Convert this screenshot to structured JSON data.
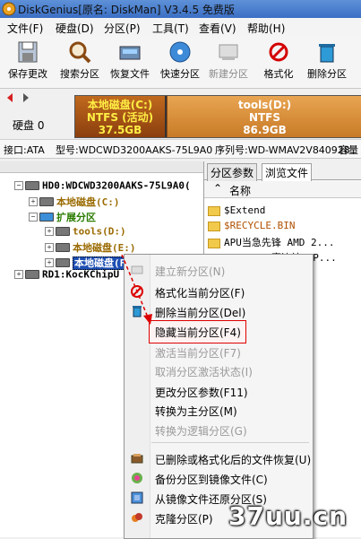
{
  "window": {
    "title": "DiskGenius[原名: DiskMan] V3.4.5 免费版"
  },
  "menu": [
    "文件(F)",
    "硬盘(D)",
    "分区(P)",
    "工具(T)",
    "查看(V)",
    "帮助(H)"
  ],
  "toolbar": [
    {
      "label": "保存更改",
      "icon": "save-icon",
      "enabled": true
    },
    {
      "label": "搜索分区",
      "icon": "search-icon",
      "enabled": true
    },
    {
      "label": "恢复文件",
      "icon": "recover-icon",
      "enabled": true
    },
    {
      "label": "快速分区",
      "icon": "disk-icon",
      "enabled": true
    },
    {
      "label": "新建分区",
      "icon": "new-partition-icon",
      "enabled": false
    },
    {
      "label": "格式化",
      "icon": "format-icon",
      "enabled": true
    },
    {
      "label": "删除分区",
      "icon": "trash-icon",
      "enabled": true
    }
  ],
  "disk_panel": {
    "disk_label": "硬盘 0",
    "partitions": [
      {
        "name": "本地磁盘(C:)",
        "fs": "NTFS (活动)",
        "size": "37.5GB"
      },
      {
        "name": "tools(D:)",
        "fs": "NTFS",
        "size": "86.9GB"
      }
    ]
  },
  "info": {
    "interface": "接口:ATA",
    "model": "型号:WDCWD3200AAKS-75L9A0",
    "serial": "序列号:WD-WMAV2V840928",
    "capacity": "容量"
  },
  "tree": {
    "hd0": "HD0:WDCWD3200AAKS-75L9A0(",
    "c": "本地磁盘(C:)",
    "ext": "扩展分区",
    "d": "tools(D:)",
    "e": "本地磁盘(E:)",
    "f": "本地磁盘(F:)",
    "rd1": "RD1:KocKChipU"
  },
  "tabs": [
    "分区参数",
    "浏览文件"
  ],
  "file_list": {
    "header": "名称",
    "items": [
      "$Extend",
      "$RECYCLE.BIN",
      "APU当急先锋 AMD 2...",
      "Aton-ION赛边站 AP..."
    ]
  },
  "context_menu": [
    {
      "label": "建立新分区(N)",
      "enabled": false,
      "icon": "new-partition-icon"
    },
    {
      "label": "格式化当前分区(F)",
      "enabled": true,
      "icon": "format-icon"
    },
    {
      "label": "删除当前分区(Del)",
      "enabled": true,
      "icon": "trash-icon"
    },
    {
      "label": "隐藏当前分区(F4)",
      "enabled": true,
      "icon": "",
      "highlighted": true
    },
    {
      "label": "激活当前分区(F7)",
      "enabled": false,
      "icon": ""
    },
    {
      "label": "取消分区激活状态(I)",
      "enabled": false,
      "icon": ""
    },
    {
      "label": "更改分区参数(F11)",
      "enabled": true,
      "icon": ""
    },
    {
      "label": "转换为主分区(M)",
      "enabled": true,
      "icon": ""
    },
    {
      "label": "转换为逻辑分区(G)",
      "enabled": false,
      "icon": ""
    },
    {
      "label": "已删除或格式化后的文件恢复(U)",
      "enabled": true,
      "icon": "recover-icon"
    },
    {
      "label": "备份分区到镜像文件(C)",
      "enabled": true,
      "icon": "backup-icon"
    },
    {
      "label": "从镜像文件还原分区(S)",
      "enabled": true,
      "icon": "restore-icon"
    },
    {
      "label": "克隆分区(P)",
      "enabled": true,
      "icon": "clone-icon"
    }
  ],
  "watermark": "37uu.cn",
  "colors": {
    "title_bar": "#3b6fc4",
    "selection": "#1e4fb3",
    "highlight_border": "#dd0000",
    "partition_c": "#a0521a",
    "partition_d": "#d88b34"
  }
}
